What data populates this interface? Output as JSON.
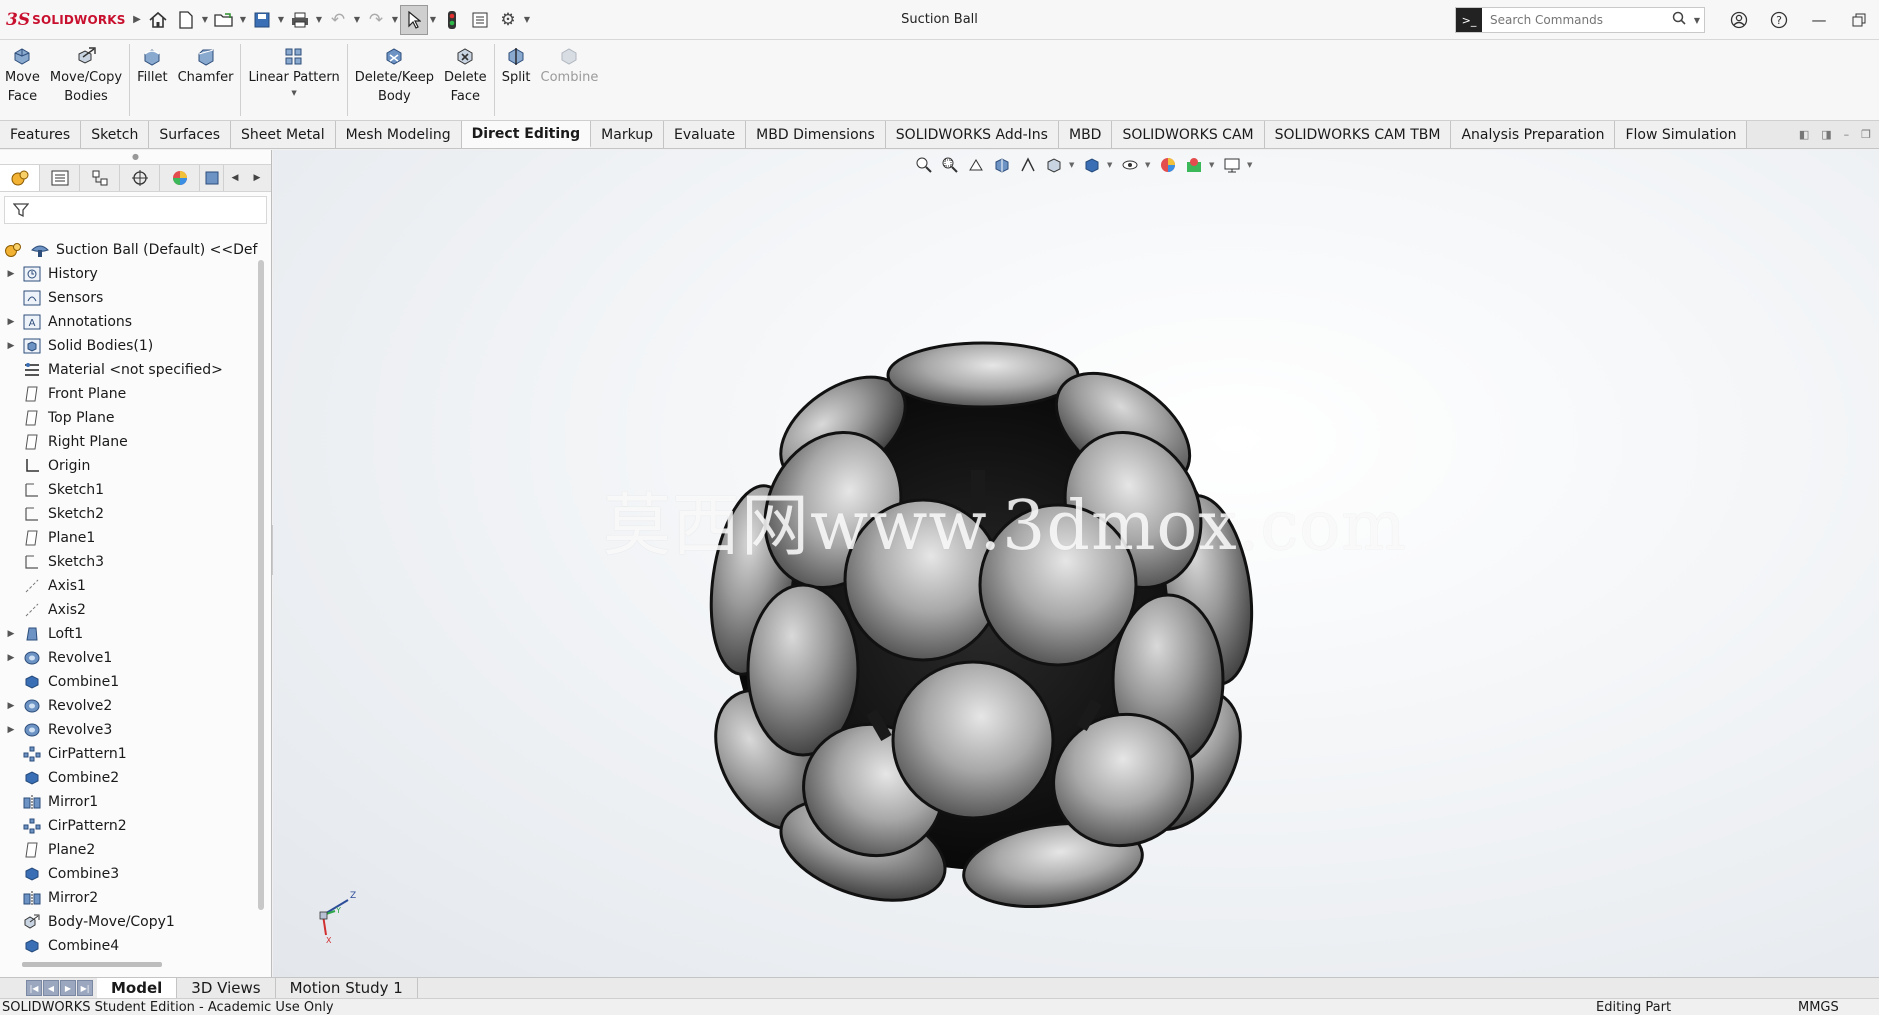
{
  "app": {
    "brand_ds": "3S",
    "brand_name": "SOLIDWORKS",
    "window_title": "Suction Ball"
  },
  "search": {
    "placeholder": "Search Commands"
  },
  "commands": [
    {
      "label": "Move\nFace",
      "l1": "Move",
      "l2": "Face"
    },
    {
      "label": "Move/Copy Bodies",
      "l1": "Move/Copy",
      "l2": "Bodies"
    },
    {
      "label": "Fillet",
      "l1": "Fillet",
      "l2": ""
    },
    {
      "label": "Chamfer",
      "l1": "Chamfer",
      "l2": ""
    },
    {
      "label": "Linear Pattern",
      "l1": "Linear Pattern",
      "l2": ""
    },
    {
      "label": "Delete/Keep Body",
      "l1": "Delete/Keep",
      "l2": "Body"
    },
    {
      "label": "Delete Face",
      "l1": "Delete",
      "l2": "Face"
    },
    {
      "label": "Split",
      "l1": "Split",
      "l2": ""
    },
    {
      "label": "Combine",
      "l1": "Combine",
      "l2": ""
    }
  ],
  "tabs": [
    "Features",
    "Sketch",
    "Surfaces",
    "Sheet Metal",
    "Mesh Modeling",
    "Direct Editing",
    "Markup",
    "Evaluate",
    "MBD Dimensions",
    "SOLIDWORKS Add-Ins",
    "MBD",
    "SOLIDWORKS CAM",
    "SOLIDWORKS CAM TBM",
    "Analysis Preparation",
    "Flow Simulation"
  ],
  "tree": {
    "root": "Suction Ball (Default) <<Defa",
    "items": [
      "History",
      "Sensors",
      "Annotations",
      "Solid Bodies(1)",
      "Material <not specified>",
      "Front Plane",
      "Top Plane",
      "Right Plane",
      "Origin",
      "Sketch1",
      "Sketch2",
      "Plane1",
      "Sketch3",
      "Axis1",
      "Axis2",
      "Loft1",
      "Revolve1",
      "Combine1",
      "Revolve2",
      "Revolve3",
      "CirPattern1",
      "Combine2",
      "Mirror1",
      "CirPattern2",
      "Plane2",
      "Combine3",
      "Mirror2",
      "Body-Move/Copy1",
      "Combine4"
    ]
  },
  "watermark": "莫西网www.3dmox.com",
  "triad": {
    "z": "Z",
    "y": "Y",
    "x": "X"
  },
  "bottom_tabs": [
    "Model",
    "3D Views",
    "Motion Study 1"
  ],
  "status": {
    "left": "SOLIDWORKS Student Edition - Academic Use Only",
    "mid": "Editing Part",
    "right": "MMGS"
  }
}
